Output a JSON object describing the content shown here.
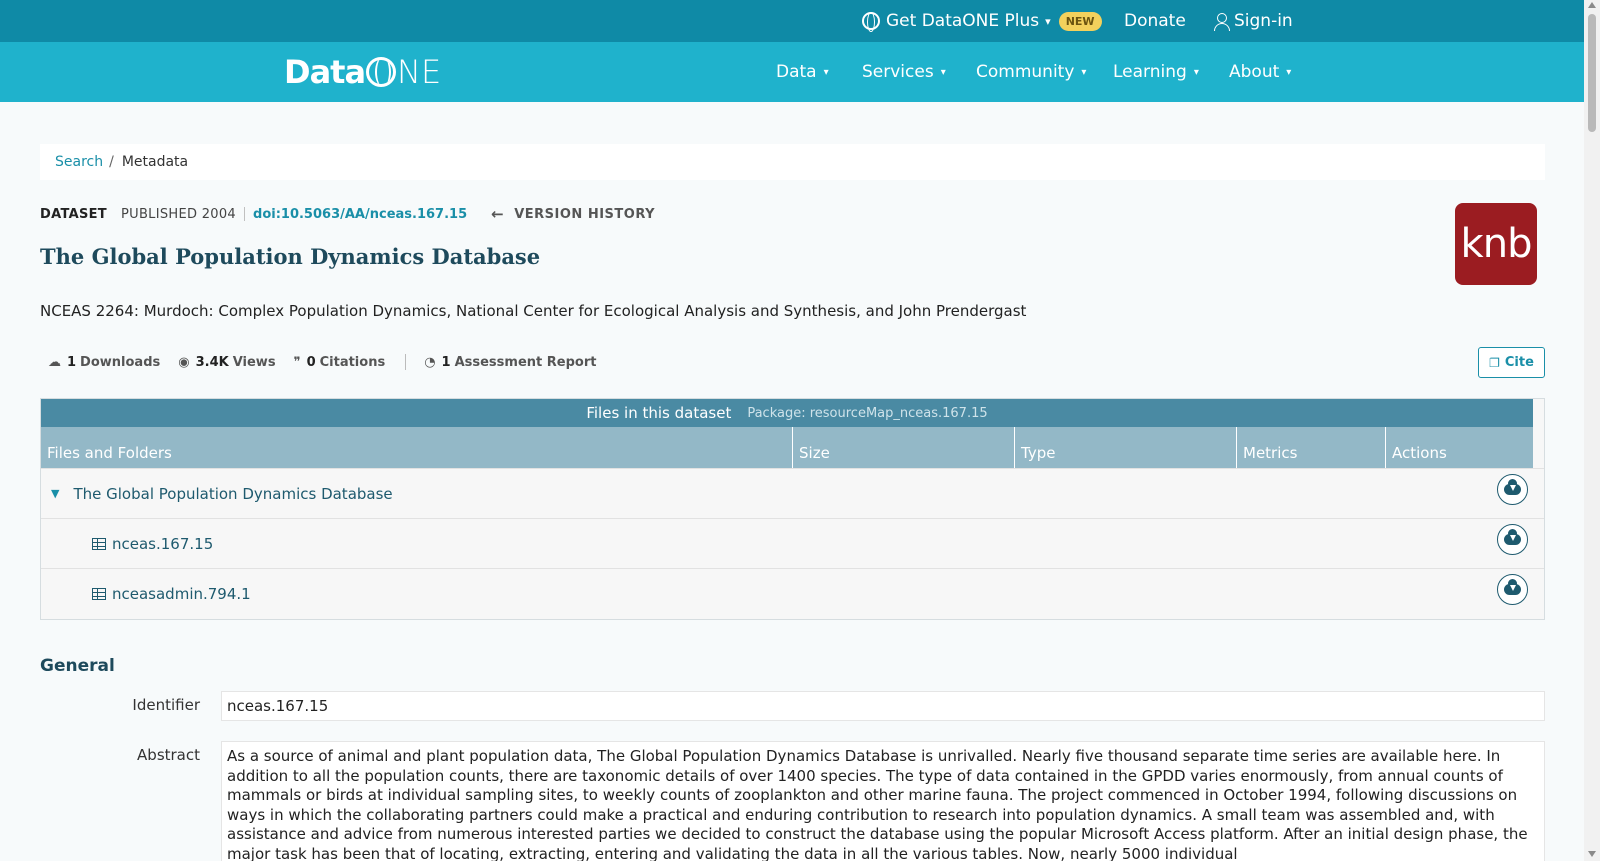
{
  "topbar": {
    "plus_label": "Get DataONE Plus",
    "new_badge": "NEW",
    "donate": "Donate",
    "signin": "Sign-in"
  },
  "nav": {
    "logo_data": "Data",
    "logo_ne": "NE",
    "items": [
      {
        "label": "Data"
      },
      {
        "label": "Services"
      },
      {
        "label": "Community"
      },
      {
        "label": "Learning"
      },
      {
        "label": "About"
      }
    ]
  },
  "breadcrumb": {
    "search": "Search",
    "separator": "/",
    "current": "Metadata"
  },
  "dataset": {
    "type": "DATASET",
    "published": "PUBLISHED 2004",
    "doi": "doi:10.5063/AA/nceas.167.15",
    "version_history": "VERSION HISTORY",
    "title": "The Global Population Dynamics Database",
    "creators": "NCEAS 2264: Murdoch: Complex Population Dynamics, National Center for Ecological Analysis and Synthesis, and John Prendergast",
    "repository_logo_text": "knb"
  },
  "metrics": {
    "downloads_num": "1",
    "downloads_label": "Downloads",
    "views_num": "3.4K",
    "views_label": "Views",
    "citations_num": "0",
    "citations_label": "Citations",
    "assessment_num": "1",
    "assessment_label": "Assessment Report"
  },
  "cite_button": "Cite",
  "files": {
    "header": "Files in this dataset",
    "package": "Package: resourceMap_nceas.167.15",
    "columns": [
      "Files and Folders",
      "Size",
      "Type",
      "Metrics",
      "Actions"
    ],
    "rows": [
      {
        "name": "The Global Population Dynamics Database",
        "kind": "folder"
      },
      {
        "name": "nceas.167.15",
        "kind": "table"
      },
      {
        "name": "nceasadmin.794.1",
        "kind": "table"
      }
    ]
  },
  "general": {
    "heading": "General",
    "identifier_label": "Identifier",
    "identifier_value": "nceas.167.15",
    "abstract_label": "Abstract",
    "abstract_value": "As a source of animal and plant population data, The Global Population Dynamics Database is unrivalled. Nearly five thousand separate time series are available here. In addition to all the population counts, there are taxonomic details of over 1400 species. The type of data contained in the GPDD varies enormously, from annual counts of mammals or birds at individual sampling sites, to weekly counts of zooplankton and other marine fauna. The project commenced in October 1994, following discussions on ways in which the collaborating partners could make a practical and enduring contribution to research into population dynamics. A small team was assembled and, with assistance and advice from numerous interested parties we decided to construct the database using the popular Microsoft Access platform. After an initial design phase, the major task has been that of locating, extracting, entering and validating the data in all the various tables. Now, nearly 5000 individual"
  },
  "colors": {
    "topbar": "#0f8aa6",
    "navbar": "#1fb2cc",
    "accent": "#1a8fa8",
    "files_header": "#4a8aa3",
    "files_columns": "#93b8c7",
    "knb": "#9b1c21"
  }
}
